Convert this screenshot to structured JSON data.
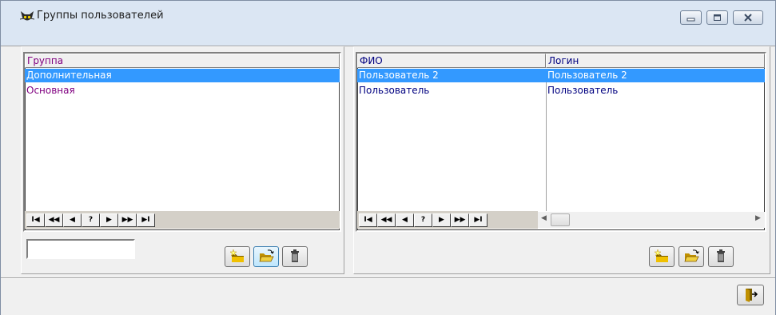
{
  "window": {
    "title": "Группы пользователей",
    "app_icon": "cat-face-icon",
    "controls": [
      "minimize-icon",
      "maximize-icon",
      "close-icon"
    ]
  },
  "groups": {
    "column_header": "Группа",
    "rows": [
      "Дополнительная",
      "Основная"
    ],
    "selected_index": 0,
    "text_color": "#800080",
    "filter_value": ""
  },
  "users": {
    "columns": [
      "ФИО",
      "Логин"
    ],
    "rows": [
      {
        "fio": "Пользователь 2",
        "login": "Пользователь 2"
      },
      {
        "fio": "Пользователь",
        "login": "Пользователь"
      }
    ],
    "selected_index": 0,
    "text_color": "#000080"
  },
  "navigator": {
    "buttons": [
      {
        "name": "first-record-button",
        "glyph": "I◀"
      },
      {
        "name": "prior-page-button",
        "glyph": "◀◀"
      },
      {
        "name": "prior-record-button",
        "glyph": "◀"
      },
      {
        "name": "search-record-button",
        "glyph": "?"
      },
      {
        "name": "next-record-button",
        "glyph": "▶"
      },
      {
        "name": "next-page-button",
        "glyph": "▶▶"
      },
      {
        "name": "last-record-button",
        "glyph": "▶I"
      }
    ]
  },
  "toolbar": {
    "icons": [
      "new-folder-icon",
      "open-folder-icon",
      "trash-icon"
    ]
  },
  "exit": {
    "icon": "exit-door-icon"
  },
  "colors": {
    "selection": "#3399ff",
    "navbar": "#d4d0c8",
    "title_bg": "#dbe6f3"
  }
}
